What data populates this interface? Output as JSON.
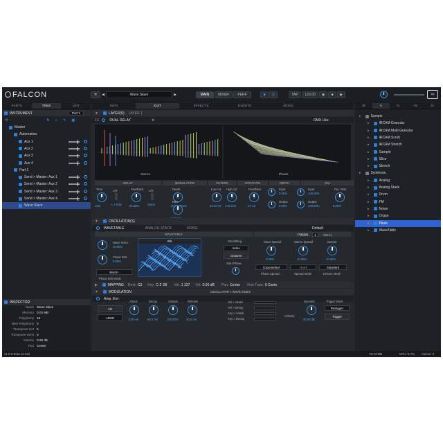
{
  "app": {
    "name": "FALCON",
    "preset": "Wave Slave"
  },
  "topbar": {
    "main": "MAIN",
    "mixer": "MIXER",
    "perf": "PERF",
    "tap": "TAP",
    "tempo": "120.00"
  },
  "left_tabs": [
    "PARTS",
    "TREE",
    "LIST"
  ],
  "instrument": {
    "label": "INSTRUMENT",
    "part": "Part 1"
  },
  "tree": [
    {
      "label": "Master",
      "indent": 1
    },
    {
      "label": "Automation",
      "indent": 2
    },
    {
      "label": "Aux 1",
      "indent": 3
    },
    {
      "label": "Aux 2",
      "indent": 3
    },
    {
      "label": "Aux 3",
      "indent": 3
    },
    {
      "label": "Aux 4",
      "indent": 3
    },
    {
      "label": "Part 1",
      "indent": 2
    },
    {
      "label": "Send > Master: Aux 1",
      "indent": 3
    },
    {
      "label": "Send > Master: Aux 2",
      "indent": 3
    },
    {
      "label": "Send > Master: Aux 3",
      "indent": 3
    },
    {
      "label": "Send > Master: Aux 4",
      "indent": 3
    },
    {
      "label": "Wave Slave",
      "indent": 3
    }
  ],
  "inspector": {
    "title": "INSPECTOR",
    "rows": [
      {
        "k": "Name",
        "v": "Wave Slave"
      },
      {
        "k": "Memory",
        "v": "0.04 MB"
      },
      {
        "k": "Polyphony",
        "v": "16"
      },
      {
        "k": "Note Polyphony",
        "v": "0"
      },
      {
        "k": "Transpose Oct",
        "v": "0"
      },
      {
        "k": "Transpose Semi",
        "v": "0"
      },
      {
        "k": "Volume",
        "v": "0.00 dB"
      },
      {
        "k": "Pan",
        "v": "Center"
      }
    ]
  },
  "center_tabs": [
    "INFO",
    "EDIT",
    "EFFECTS",
    "EVENTS",
    "MODS"
  ],
  "layer": {
    "label": "LAYER(S)",
    "name": "LAYER 1",
    "fx": "FX",
    "effect": "DUAL DELAY",
    "rmx": "RMX Like"
  },
  "scopes": {
    "stereo": "Stereo",
    "phase": "Phase"
  },
  "fx_sections": [
    "DELAY",
    "MODULATION",
    "FILTERS",
    "ROTATION",
    "WIDTH",
    "MIX"
  ],
  "fx_params": [
    {
      "label": "Time",
      "value": "1/32"
    },
    {
      "label": "L/R",
      "value": "L x 5.64"
    },
    {
      "label": "Feedback",
      "value": "92.28%"
    },
    {
      "label": "L/R",
      "value": "Same"
    },
    {
      "label": "Depth",
      "value": "20.00 Cents"
    },
    {
      "label": "Rate",
      "value": "0.33 Hz"
    },
    {
      "label": "Low cut",
      "value": "20.00 Hz"
    },
    {
      "label": "High cut",
      "value": "4.51 kHz"
    },
    {
      "label": "Feedback",
      "value": "-27.13"
    },
    {
      "label": "Input",
      "value": "0.00%"
    },
    {
      "label": "Output",
      "value": "0.00%"
    },
    {
      "label": "Input",
      "value": "100.00%"
    },
    {
      "label": "Output",
      "value": "100.00%"
    },
    {
      "label": "Dry / Wet",
      "value": "5.00%"
    }
  ],
  "osc": {
    "label": "OSCILLATOR(S)",
    "type": "WAVETABLE",
    "tabs": [
      "ANALOG STACK",
      "NOISE"
    ],
    "default": "Default",
    "sections": [
      "WAVETABLE",
      "UNISON"
    ],
    "wave_index": {
      "label": "Wave Index",
      "value": "35.86%"
    },
    "phase_dist": {
      "label": "Phase Dist",
      "value": "0.00%"
    },
    "bend": "Bend+",
    "pd_mode": "Phase Dist Mode",
    "silk": "Silk",
    "smoothing": "Smoothing",
    "index": "Index",
    "octaves": "Octaves",
    "start_phase": "Start Phase",
    "voices_label": "Voices",
    "voices": "1",
    "stereo": "Stereo",
    "wave_spread": {
      "label": "Wave Spread",
      "value": "0.00%"
    },
    "stereo_spread": {
      "label": "Stereo Spread",
      "value": "10.00%"
    },
    "detune": {
      "label": "Detune",
      "value": "10.00%"
    },
    "phase_spread_mode": "Exponential",
    "hard": "Hard",
    "standard": "Standard",
    "footer": [
      "Phase Spread",
      "Spread Mode",
      "Detune Mode"
    ]
  },
  "mapping": {
    "label": "MAPPING",
    "root_k": "Root:",
    "root": "C3",
    "key_k": "Key:",
    "key": "C-2 G8",
    "vel_k": "Vel:",
    "vel": "1 127",
    "vol_k": "Vol:",
    "vol": "0.00 dB",
    "pan_k": "Pan:",
    "pan": "Center",
    "fine_k": "Fine Tune:",
    "fine": "0 Cents"
  },
  "modulation": {
    "label": "MODULATION",
    "target": "OSCILLATOR > WAVE INDEX",
    "env": "Amp. Env",
    "ad": "AD",
    "adsr": "ADSR",
    "knobs": [
      {
        "label": "Attack",
        "value": "1.00 ms"
      },
      {
        "label": "Decay",
        "value": "50.0 ms"
      },
      {
        "label": "Sustain",
        "value": "100.00%"
      },
      {
        "label": "Release",
        "value": "10.0 ms"
      }
    ],
    "routes": [
      "Vel > Attack",
      "Vel > Decay",
      "Key > Attack",
      "Key > Decay"
    ],
    "velocity": "Velocity",
    "dynamic": {
      "label": "Dynamic",
      "value": "20.00 dB"
    },
    "trigger_mode": "Trigger Mode",
    "retrigger": "Retrigger",
    "trigger": "Trigger"
  },
  "right_tabs": [
    "fx",
    "~fx",
    "☷"
  ],
  "browser": [
    {
      "label": "Sample",
      "level": 0
    },
    {
      "label": "IRCAM Granular",
      "level": 1
    },
    {
      "label": "IRCAM Multi Granular",
      "level": 1
    },
    {
      "label": "IRCAM Scrub",
      "level": 1
    },
    {
      "label": "IRCAM Stretch",
      "level": 1
    },
    {
      "label": "Sample",
      "level": 1
    },
    {
      "label": "Slice",
      "level": 1
    },
    {
      "label": "Stretch",
      "level": 1
    },
    {
      "label": "Synthesis",
      "level": 0
    },
    {
      "label": "Analog",
      "level": 1
    },
    {
      "label": "Analog Stack",
      "level": 1
    },
    {
      "label": "Drum",
      "level": 1
    },
    {
      "label": "FM",
      "level": 1
    },
    {
      "label": "Noise",
      "level": 1
    },
    {
      "label": "Organ",
      "level": 1
    },
    {
      "label": "Pluck",
      "level": 1
    },
    {
      "label": "WaveTable",
      "level": 1
    }
  ],
  "status": {
    "version": "v1.0.0-beta.13 x64",
    "memory": "79.43 MB",
    "cpu": "CPU: 5.7%",
    "voices": "Voices: 0"
  }
}
